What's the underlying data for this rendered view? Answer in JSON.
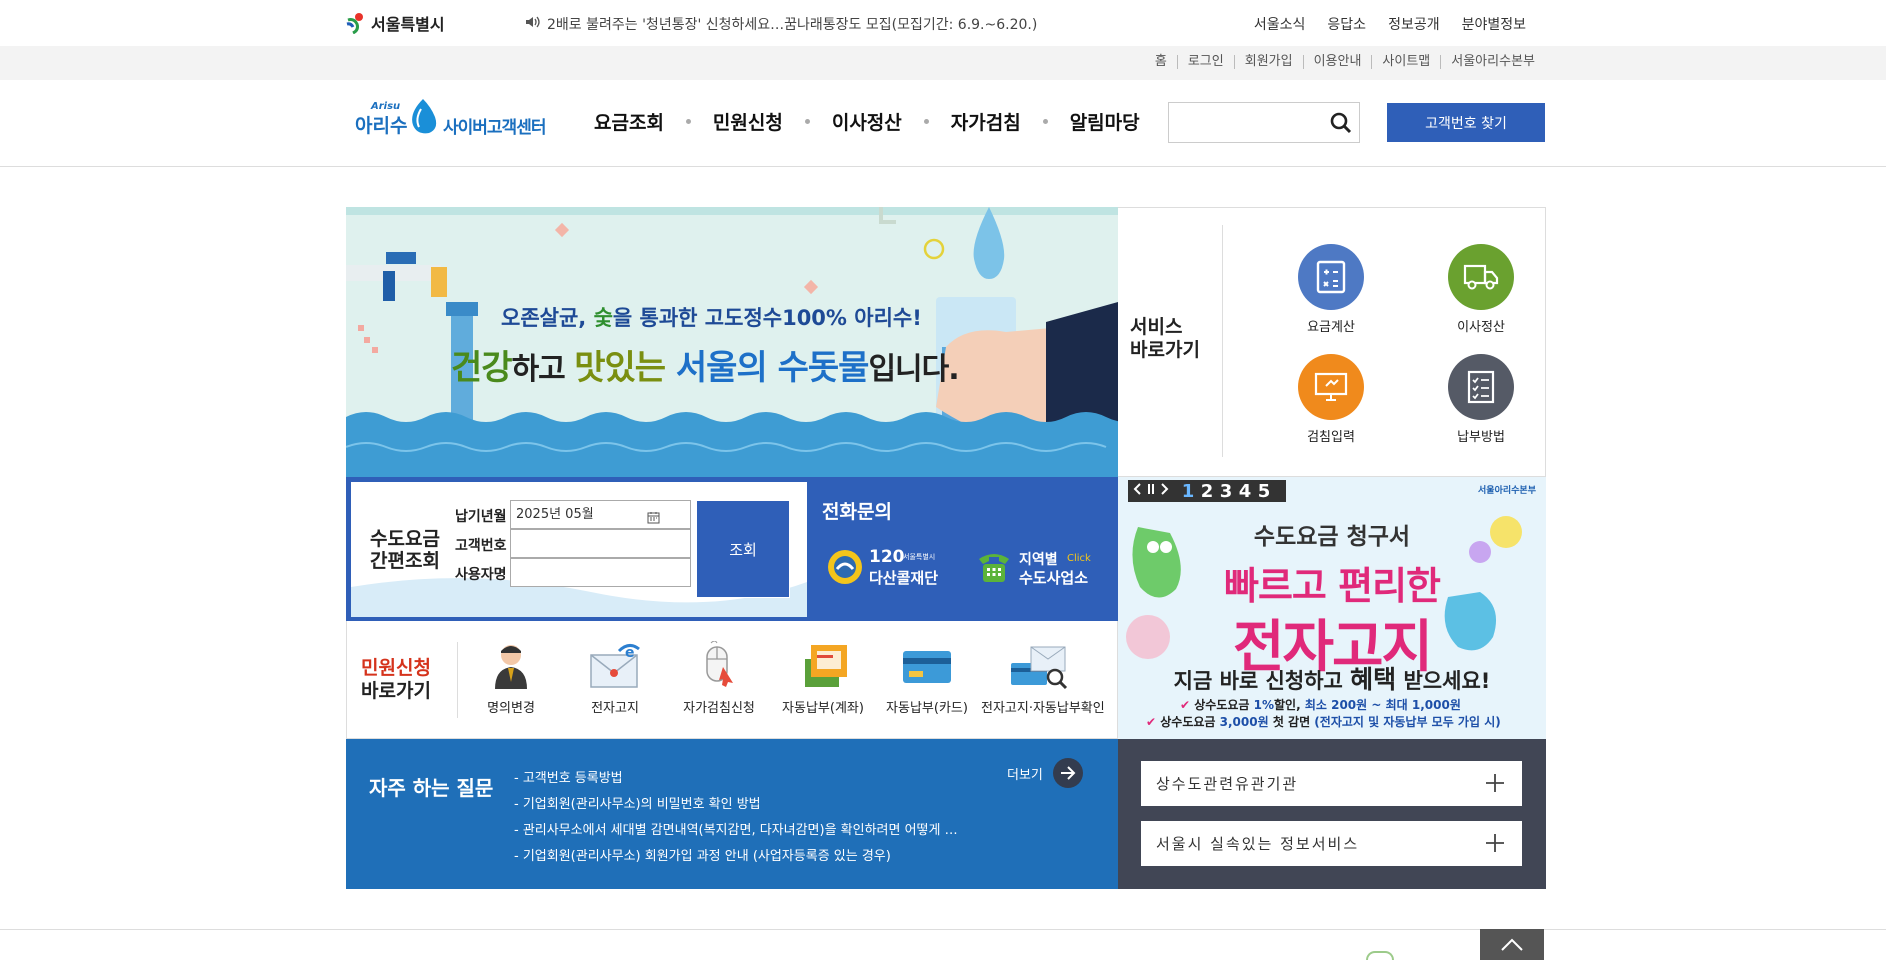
{
  "topbar": {
    "city_name": "서울특별시",
    "notice": "2배로 불려주는 '청년통장' 신청하세요…꿈나래통장도 모집(모집기간: 6.9.~6.20.)",
    "nav": [
      "서울소식",
      "응답소",
      "정보공개",
      "분야별정보"
    ]
  },
  "utility": {
    "links": [
      "홈",
      "로그인",
      "회원가입",
      "이용안내",
      "사이트맵",
      "서울아리수본부"
    ]
  },
  "header": {
    "logo_small": "Arisu",
    "logo_main": "아리수",
    "logo_sub": "사이버고객센터",
    "gnb": [
      "요금조회",
      "민원신청",
      "이사정산",
      "자가검침",
      "알림마당"
    ],
    "search_placeholder": "",
    "find_customer_button": "고객번호 찾기"
  },
  "banner": {
    "line1_prefix": "오존살균, ",
    "line1_highlight": "숯",
    "line1_suffix": "을 통과한 고도정수100% 아리수!",
    "line2_a": "건강",
    "line2_b": "하고 ",
    "line2_c": "맛있는 ",
    "line2_d": "서울의 수돗물",
    "line2_e": "입니다."
  },
  "service": {
    "title_line1": "서비스",
    "title_line2": "바로가기",
    "items": [
      {
        "label": "요금계산",
        "color": "#4e79c4"
      },
      {
        "label": "이사정산",
        "color": "#6aa12f"
      },
      {
        "label": "검침입력",
        "color": "#f08a1c"
      },
      {
        "label": "납부방법",
        "color": "#555a66"
      }
    ]
  },
  "quick_lookup": {
    "title_line1": "수도요금",
    "title_line2": "간편조회",
    "year_month_label": "납기년월",
    "year_month_value": "2025년 05월",
    "customer_no_label": "고객번호",
    "user_name_label": "사용자명",
    "submit": "조회"
  },
  "phone": {
    "title": "전화문의",
    "dasan_num": "120",
    "dasan_small": "서울특별시",
    "dasan_name": "다산콜재단",
    "region_label": "지역별",
    "region_click": "Click",
    "region_name": "수도사업소"
  },
  "ebill": {
    "pager": [
      "1",
      "2",
      "3",
      "4",
      "5"
    ],
    "brand": "서울아리수본부",
    "subtitle": "수도요금 청구서",
    "main1": "빠르고 편리한",
    "main2": "전자고지",
    "cta_a": "지금 바로 신청하고 ",
    "cta_b": "혜택",
    "cta_c": " 받으세요!",
    "note1_a": "상수도요금 ",
    "note1_b": "1%",
    "note1_c": "할인, ",
    "note1_d": "최소 200원 ~ 최대 1,000원",
    "note2_a": "상수도요금 ",
    "note2_b": "3,000원",
    "note2_c": " 첫 감면 ",
    "note2_d": "(전자고지 및 자동납부 모두 가입 시)"
  },
  "civil": {
    "title_line1": "민원신청",
    "title_line2": "바로가기",
    "items": [
      "명의변경",
      "전자고지",
      "자가검침신청",
      "자동납부(계좌)",
      "자동납부(카드)",
      "전자고지·자동납부확인"
    ]
  },
  "faq": {
    "title": "자주 하는 질문",
    "more": "더보기",
    "items": [
      "- 고객번호 등록방법",
      "- 기업회원(관리사무소)의 비밀번호 확인 방법",
      "- 관리사무소에서 세대별 감면내역(복지감면, 다자녀감면)을 확인하려면 어떻게 …",
      "- 기업회원(관리사무소) 회원가입 과정 안내 (사업자등록증 있는 경우)"
    ]
  },
  "related": {
    "items": [
      "상수도관련유관기관",
      "서울시 실속있는 정보서비스"
    ]
  },
  "colors": {
    "primary_blue": "#2f5fb8",
    "faq_blue": "#1f6fb8",
    "dark_panel": "#414655",
    "pink": "#e0297a"
  }
}
